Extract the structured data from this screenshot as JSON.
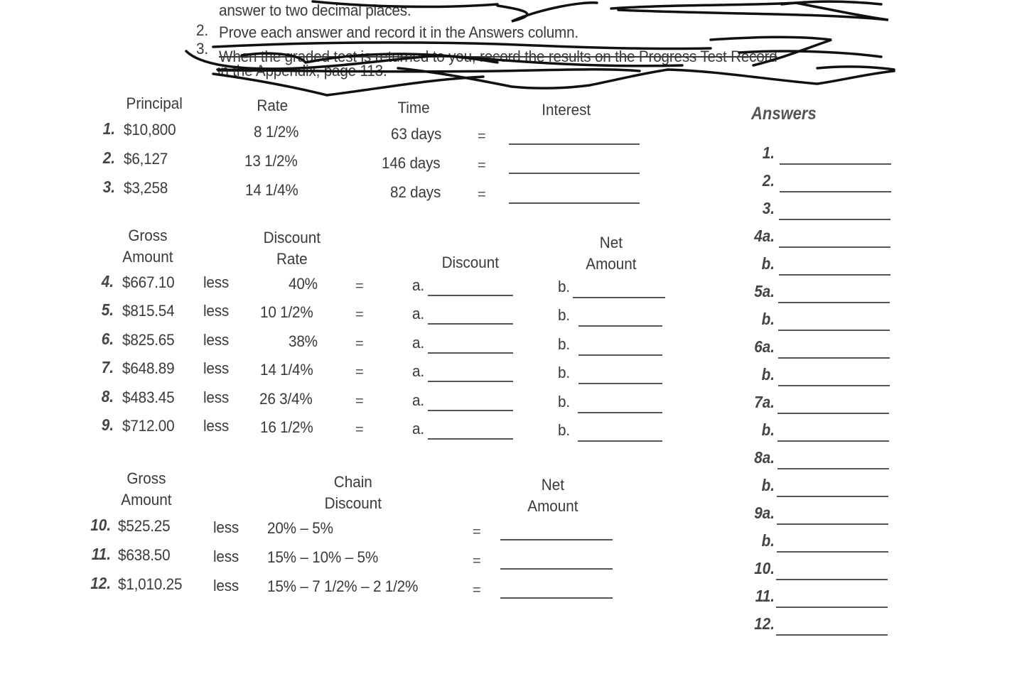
{
  "instructions": {
    "line1_partial": "answer to two decimal places.",
    "item2_num": "2.",
    "item2": "Prove each answer and record it in the Answers column.",
    "item3_num": "3.",
    "item3_line1": "When the graded test is returned to you, record the results on the Progress Test Record",
    "item3_line2": "in the Appendix, page 113."
  },
  "interest_section": {
    "headers": {
      "principal": "Principal",
      "rate": "Rate",
      "time": "Time",
      "interest": "Interest"
    },
    "rows": [
      {
        "num": "1.",
        "principal": "$10,800",
        "rate": "8 1/2%",
        "time": "63 days",
        "eq": "="
      },
      {
        "num": "2.",
        "principal": "$6,127",
        "rate": "13 1/2%",
        "time": "146 days",
        "eq": "="
      },
      {
        "num": "3.",
        "principal": "$3,258",
        "rate": "14 1/4%",
        "time": "82 days",
        "eq": "="
      }
    ]
  },
  "discount_section": {
    "headers": {
      "gross_1": "Gross",
      "gross_2": "Amount",
      "rate_1": "Discount",
      "rate_2": "Rate",
      "discount": "Discount",
      "net_1": "Net",
      "net_2": "Amount"
    },
    "rows": [
      {
        "num": "4.",
        "gross": "$667.10",
        "less": "less",
        "rate": "40%",
        "eq": "=",
        "a": "a.",
        "b": "b."
      },
      {
        "num": "5.",
        "gross": "$815.54",
        "less": "less",
        "rate": "10 1/2%",
        "eq": "=",
        "a": "a.",
        "b": "b."
      },
      {
        "num": "6.",
        "gross": "$825.65",
        "less": "less",
        "rate": "38%",
        "eq": "=",
        "a": "a.",
        "b": "b."
      },
      {
        "num": "7.",
        "gross": "$648.89",
        "less": "less",
        "rate": "14 1/4%",
        "eq": "=",
        "a": "a.",
        "b": "b."
      },
      {
        "num": "8.",
        "gross": "$483.45",
        "less": "less",
        "rate": "26 3/4%",
        "eq": "=",
        "a": "a.",
        "b": "b."
      },
      {
        "num": "9.",
        "gross": "$712.00",
        "less": "less",
        "rate": "16 1/2%",
        "eq": "=",
        "a": "a.",
        "b": "b."
      }
    ]
  },
  "chain_section": {
    "headers": {
      "gross_1": "Gross",
      "gross_2": "Amount",
      "chain_1": "Chain",
      "chain_2": "Discount",
      "net_1": "Net",
      "net_2": "Amount"
    },
    "rows": [
      {
        "num": "10.",
        "gross": "$525.25",
        "less": "less",
        "chain": "20% – 5%",
        "eq": "="
      },
      {
        "num": "11.",
        "gross": "$638.50",
        "less": "less",
        "chain": "15% – 10% – 5%",
        "eq": "="
      },
      {
        "num": "12.",
        "gross": "$1,010.25",
        "less": "less",
        "chain": "15% – 7 1/2% – 2 1/2%",
        "eq": "="
      }
    ]
  },
  "answers": {
    "title": "Answers",
    "labels": [
      "1.",
      "2.",
      "3.",
      "4a.",
      "b.",
      "5a.",
      "b.",
      "6a.",
      "b.",
      "7a.",
      "b.",
      "8a.",
      "b.",
      "9a.",
      "b.",
      "10.",
      "11.",
      "12."
    ]
  }
}
